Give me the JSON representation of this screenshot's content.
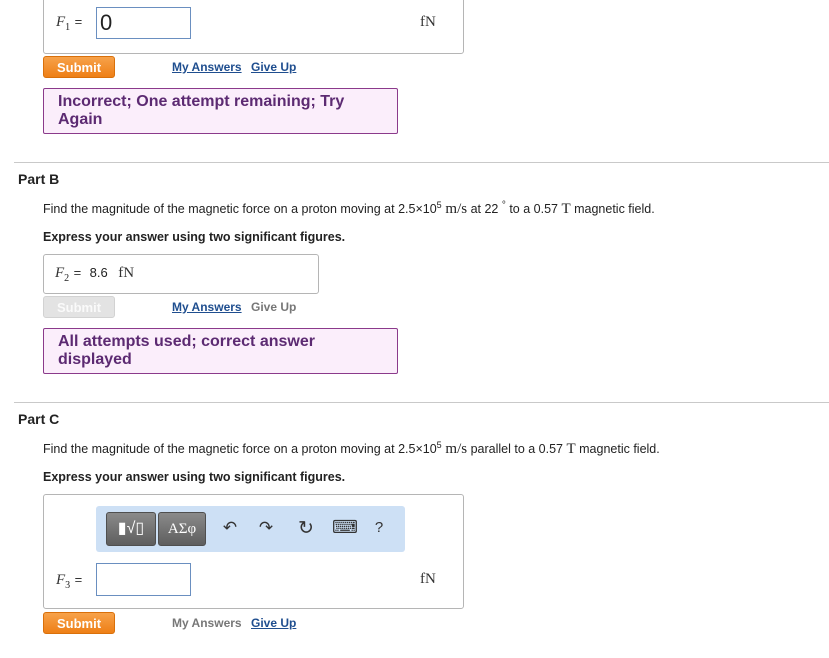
{
  "part_a": {
    "var_letter": "F",
    "var_sub": "1",
    "equals": "=",
    "input_value": "0",
    "unit": "fN",
    "submit_label": "Submit",
    "my_answers_label": "My Answers",
    "give_up_label": "Give Up",
    "feedback": "Incorrect; One attempt remaining; Try Again"
  },
  "part_b": {
    "title": "Part B",
    "question": {
      "lead": "Find the magnitude of the magnetic force on a proton moving at 2.5×10",
      "exp": "5",
      "speed_unit": " m/s",
      "mid": " at 22 ",
      "degree": "°",
      "mid2": "  to a 0.57 ",
      "field_unit": "T",
      "tail": " magnetic field."
    },
    "instruction": "Express your answer using two significant figures.",
    "var_letter": "F",
    "var_sub": "2",
    "equals": "=",
    "answer_value": "8.6",
    "unit": "fN",
    "submit_label": "Submit",
    "my_answers_label": "My Answers",
    "give_up_label": "Give Up",
    "feedback": "All attempts used; correct answer displayed"
  },
  "part_c": {
    "title": "Part C",
    "question": {
      "lead": "Find the magnitude of the magnetic force on a proton moving at 2.5×10",
      "exp": "5",
      "speed_unit": " m/s",
      "mid": " parallel to a 0.57 ",
      "field_unit": "T",
      "tail": " magnetic field."
    },
    "instruction": "Express your answer using two significant figures.",
    "toolbar": {
      "templates_label": "▮√▯",
      "symbols_label": "ΑΣφ",
      "undo_icon": "↶",
      "redo_icon": "↷",
      "reset_icon": "↻",
      "keyboard_icon": "⌨",
      "help_label": "?"
    },
    "var_letter": "F",
    "var_sub": "3",
    "equals": "=",
    "input_value": "",
    "unit": "fN",
    "submit_label": "Submit",
    "my_answers_label": "My Answers",
    "give_up_label": "Give Up"
  },
  "colors": {
    "submit_orange": "#ee7f16",
    "link_blue": "#1f4e8f",
    "feedback_border": "#8b3a8b",
    "feedback_bg": "#fbeefb",
    "toolbar_bg": "#cde0f5"
  }
}
